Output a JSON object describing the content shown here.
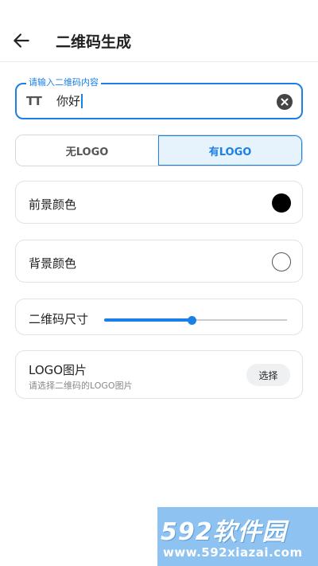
{
  "header": {
    "back_icon": "arrow-left-icon",
    "title": "二维码生成"
  },
  "input": {
    "label": "请输入二维码内容",
    "value": "你好",
    "leading_icon": "text-size-icon",
    "leading_glyph": "TT",
    "clear_icon": "clear-circle-icon"
  },
  "logo_mode": {
    "options": [
      "无LOGO",
      "有LOGO"
    ],
    "selected": "有LOGO"
  },
  "foreground": {
    "label": "前景颜色",
    "color": "#000000"
  },
  "background": {
    "label": "背景颜色",
    "color": "#ffffff"
  },
  "size": {
    "label": "二维码尺寸",
    "value_fraction": 0.48
  },
  "logo_image": {
    "title": "LOGO图片",
    "subtitle": "请选择二维码的LOGO图片",
    "button_label": "选择"
  },
  "watermark": {
    "brand": "592软件园",
    "url": "www.592xiazai.com"
  },
  "colors": {
    "accent": "#1a7fe6",
    "selected_segment_bg": "#e7f3fc"
  }
}
